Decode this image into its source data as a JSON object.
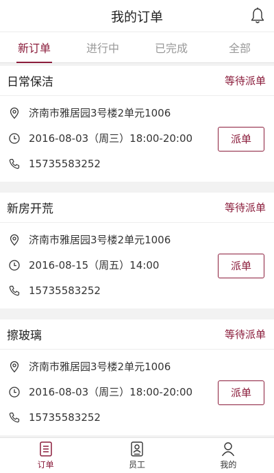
{
  "header": {
    "title": "我的订单"
  },
  "tabs": [
    {
      "label": "新订单"
    },
    {
      "label": "进行中"
    },
    {
      "label": "已完成"
    },
    {
      "label": "全部"
    }
  ],
  "orders": [
    {
      "service": "日常保洁",
      "status": "等待派单",
      "address": "济南市雅居园3号楼2单元1006",
      "time": "2016-08-03（周三）18:00-20:00",
      "phone": "15735583252",
      "action": "派单"
    },
    {
      "service": "新房开荒",
      "status": "等待派单",
      "address": "济南市雅居园3号楼2单元1006",
      "time": "2016-08-15（周五）14:00",
      "phone": "15735583252",
      "action": "派单"
    },
    {
      "service": "擦玻璃",
      "status": "等待派单",
      "address": "济南市雅居园3号楼2单元1006",
      "time": "2016-08-03（周三）18:00-20:00",
      "phone": "15735583252",
      "action": "派单"
    }
  ],
  "tabbar": [
    {
      "label": "订单",
      "icon": "order-icon"
    },
    {
      "label": "员工",
      "icon": "staff-icon"
    },
    {
      "label": "我的",
      "icon": "user-icon"
    }
  ],
  "colors": {
    "accent": "#8a1b3a"
  }
}
